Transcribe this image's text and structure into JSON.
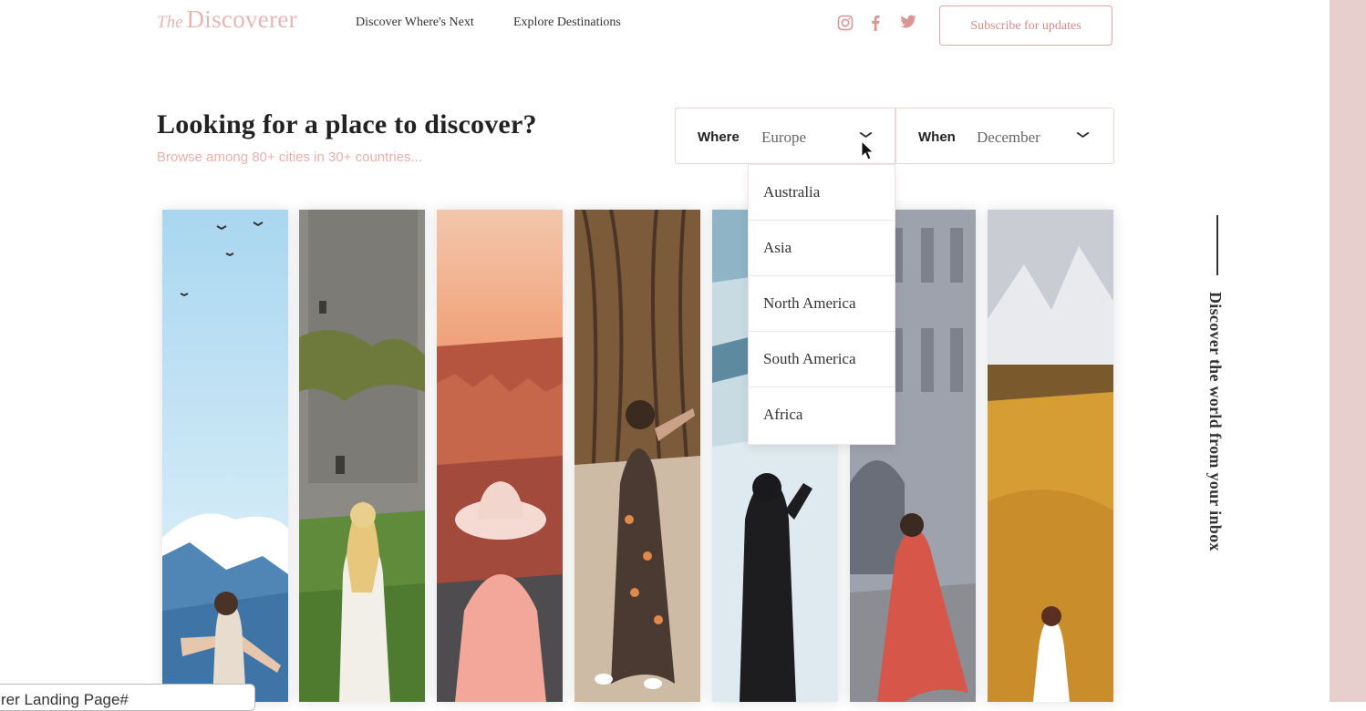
{
  "header": {
    "logo_prefix": "The",
    "logo_name": "Discoverer",
    "nav": [
      "Discover Where's Next",
      "Explore Destinations"
    ],
    "social_icons": [
      "instagram-icon",
      "facebook-icon",
      "twitter-icon"
    ],
    "subscribe_label": "Subscribe for updates"
  },
  "hero": {
    "headline": "Looking for a place to discover?",
    "subheadline": "Browse among 80+ cities in 30+ countries..."
  },
  "search": {
    "where_label": "Where",
    "where_value": "Europe",
    "when_label": "When",
    "when_value": "December",
    "where_options": [
      "Australia",
      "Asia",
      "North America",
      "South America",
      "Africa"
    ]
  },
  "side_caption": "Discover the world from your inbox",
  "tooltip": "rer Landing Page#",
  "colors": {
    "accent": "#e0a6a2",
    "accent_text": "#d38c88",
    "right_strip": "#e6cfcd"
  }
}
